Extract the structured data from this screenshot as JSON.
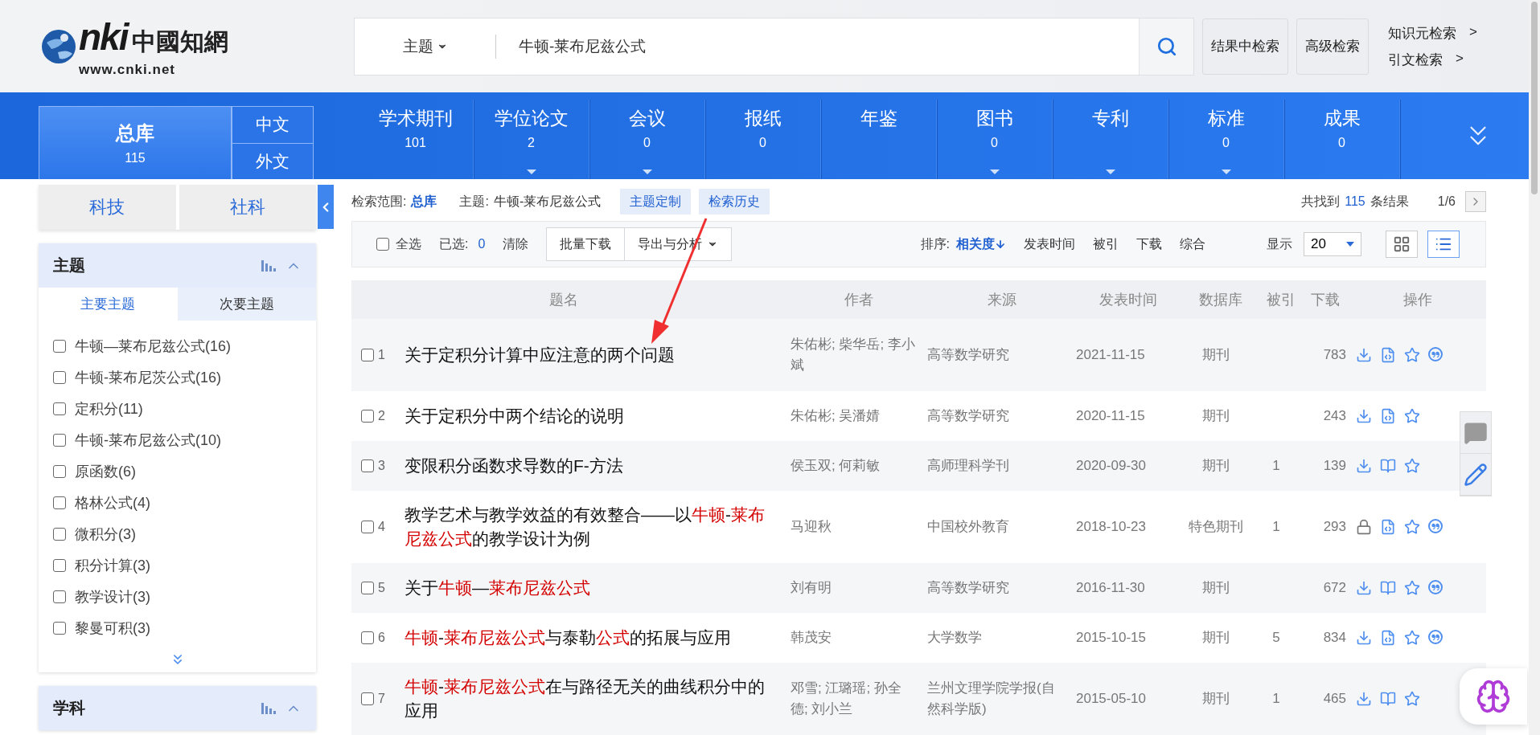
{
  "header": {
    "logo": {
      "mark": "nki",
      "name": "中國知網",
      "url": "www.cnki.net"
    },
    "search": {
      "field": "主题",
      "value": "牛顿-莱布尼兹公式"
    },
    "buttons": [
      "结果中检索",
      "高级检索"
    ],
    "links": [
      {
        "label": "知识元检索",
        "arrow": ">"
      },
      {
        "label": "引文检索",
        "arrow": ">"
      }
    ]
  },
  "nav": {
    "database": {
      "label": "总库",
      "count": "115",
      "selected": true,
      "languages": [
        "中文",
        "外文"
      ]
    },
    "items": [
      {
        "label": "学术期刊",
        "count": "101",
        "has_menu": false
      },
      {
        "label": "学位论文",
        "count": "2",
        "has_menu": true
      },
      {
        "label": "会议",
        "count": "0",
        "has_menu": true
      },
      {
        "label": "报纸",
        "count": "0",
        "has_menu": false
      },
      {
        "label": "年鉴",
        "has_menu": false
      },
      {
        "label": "图书",
        "count": "0",
        "has_menu": true
      },
      {
        "label": "专利",
        "has_menu": true
      },
      {
        "label": "标准",
        "count": "0",
        "has_menu": true
      },
      {
        "label": "成果",
        "count": "0",
        "has_menu": false
      }
    ]
  },
  "sidebar": {
    "categories": [
      "科技",
      "社科"
    ],
    "topic_panel": {
      "title": "主题",
      "tabs": [
        {
          "label": "主要主题",
          "selected": true
        },
        {
          "label": "次要主题",
          "selected": false
        }
      ],
      "items": [
        {
          "label": "牛顿—莱布尼兹公式(16)",
          "checked": false
        },
        {
          "label": "牛顿-莱布尼茨公式(16)",
          "checked": false
        },
        {
          "label": "定积分(11)",
          "checked": false
        },
        {
          "label": "牛顿-莱布尼兹公式(10)",
          "checked": false
        },
        {
          "label": "原函数(6)",
          "checked": false
        },
        {
          "label": "格林公式(4)",
          "checked": false
        },
        {
          "label": "微积分(3)",
          "checked": false
        },
        {
          "label": "积分计算(3)",
          "checked": false
        },
        {
          "label": "教学设计(3)",
          "checked": false
        },
        {
          "label": "黎曼可积(3)",
          "checked": false
        }
      ]
    },
    "next_panel": {
      "title": "学科"
    }
  },
  "results": {
    "scope_label": "检索范围:",
    "scope": "总库",
    "query_label": "主题:",
    "query": "牛顿-莱布尼兹公式",
    "tags": [
      "主题定制",
      "检索历史"
    ],
    "found_prefix": "共找到",
    "found_count": "115",
    "found_suffix": "条结果",
    "page": "1/6",
    "toolbar": {
      "select_all": {
        "label": "全选",
        "checked": false
      },
      "selected_label": "已选:",
      "selected_count": "0",
      "clear": "清除",
      "buttons": [
        {
          "label": "批量下载",
          "has_menu": false
        },
        {
          "label": "导出与分析",
          "has_menu": true
        }
      ],
      "sort_label": "排序:",
      "sort_options": [
        {
          "label": "相关度",
          "selected": true
        },
        {
          "label": "发表时间",
          "selected": false
        },
        {
          "label": "被引",
          "selected": false
        },
        {
          "label": "下载",
          "selected": false
        },
        {
          "label": "综合",
          "selected": false
        }
      ],
      "display_label": "显示",
      "page_size": "20",
      "views": [
        {
          "kind": "grid",
          "selected": false
        },
        {
          "kind": "list",
          "selected": true
        }
      ]
    },
    "columns": [
      "题名",
      "作者",
      "来源",
      "发表时间",
      "数据库",
      "被引",
      "下载",
      "操作"
    ],
    "rows": [
      {
        "number": "1",
        "checked": false,
        "title": [
          {
            "text": "关于定积分计算中应注意的两个问题",
            "hit": false
          }
        ],
        "authors": "朱佑彬; 柴华岳; 李小斌",
        "source": "高等数学研究",
        "date": "2021-11-15",
        "database": "期刊",
        "downloads": "783",
        "actions": [
          {
            "kind": "download"
          },
          {
            "kind": "html"
          },
          {
            "kind": "star"
          },
          {
            "kind": "quote"
          }
        ]
      },
      {
        "number": "2",
        "checked": false,
        "title": [
          {
            "text": "关于定积分中两个结论的说明",
            "hit": false
          }
        ],
        "authors": "朱佑彬; 吴潘婧",
        "source": "高等数学研究",
        "date": "2020-11-15",
        "database": "期刊",
        "downloads": "243",
        "actions": [
          {
            "kind": "download"
          },
          {
            "kind": "html"
          },
          {
            "kind": "star"
          }
        ]
      },
      {
        "number": "3",
        "checked": false,
        "title": [
          {
            "text": "变限积分函数求导数的F-方法",
            "hit": false
          }
        ],
        "authors": "侯玉双; 何莉敏",
        "source": "高师理科学刊",
        "date": "2020-09-30",
        "database": "期刊",
        "cited": "1",
        "downloads": "139",
        "actions": [
          {
            "kind": "download"
          },
          {
            "kind": "read"
          },
          {
            "kind": "star"
          }
        ]
      },
      {
        "number": "4",
        "checked": false,
        "title": [
          {
            "text": "教学艺术与教学效益的有效整合——以",
            "hit": false
          },
          {
            "text": "牛顿",
            "hit": true
          },
          {
            "text": "-",
            "hit": false
          },
          {
            "text": "莱布尼兹公式",
            "hit": true
          },
          {
            "text": "的教学设计为例",
            "hit": false
          }
        ],
        "authors": "马迎秋",
        "source": "中国校外教育",
        "date": "2018-10-23",
        "database": "特色期刊",
        "cited": "1",
        "downloads": "293",
        "actions": [
          {
            "kind": "lock"
          },
          {
            "kind": "html"
          },
          {
            "kind": "star"
          },
          {
            "kind": "quote"
          }
        ]
      },
      {
        "number": "5",
        "checked": false,
        "title": [
          {
            "text": "关于",
            "hit": false
          },
          {
            "text": "牛顿",
            "hit": true
          },
          {
            "text": "—",
            "hit": false
          },
          {
            "text": "莱布尼兹公式",
            "hit": true
          }
        ],
        "authors": "刘有明",
        "source": "高等数学研究",
        "date": "2016-11-30",
        "database": "期刊",
        "downloads": "672",
        "actions": [
          {
            "kind": "download"
          },
          {
            "kind": "read"
          },
          {
            "kind": "star"
          },
          {
            "kind": "quote"
          }
        ]
      },
      {
        "number": "6",
        "checked": false,
        "title": [
          {
            "text": "牛顿",
            "hit": true
          },
          {
            "text": "-",
            "hit": false
          },
          {
            "text": "莱布尼兹公式",
            "hit": true
          },
          {
            "text": "与泰勒",
            "hit": false
          },
          {
            "text": "公式",
            "hit": true
          },
          {
            "text": "的拓展与应用",
            "hit": false
          }
        ],
        "authors": "韩茂安",
        "source": "大学数学",
        "date": "2015-10-15",
        "database": "期刊",
        "cited": "5",
        "downloads": "834",
        "actions": [
          {
            "kind": "download"
          },
          {
            "kind": "html"
          },
          {
            "kind": "star"
          },
          {
            "kind": "quote"
          }
        ]
      },
      {
        "number": "7",
        "checked": false,
        "title": [
          {
            "text": "牛顿",
            "hit": true
          },
          {
            "text": "-",
            "hit": false
          },
          {
            "text": "莱布尼兹公式",
            "hit": true
          },
          {
            "text": "在与路径无关的曲线积分中的应用",
            "hit": false
          }
        ],
        "authors": "邓雪; 江璐瑶; 孙全德; 刘小兰",
        "source": "兰州文理学院学报(自然科学版)",
        "date": "2015-05-10",
        "database": "期刊",
        "cited": "1",
        "downloads": "465",
        "actions": [
          {
            "kind": "download"
          },
          {
            "kind": "read"
          },
          {
            "kind": "star"
          }
        ]
      }
    ]
  }
}
